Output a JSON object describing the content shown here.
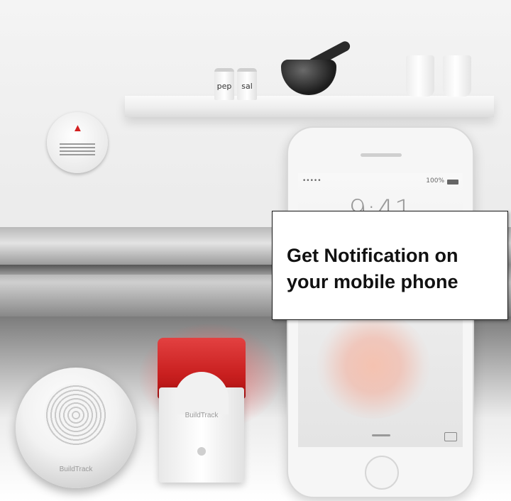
{
  "callout": {
    "line1": "Get Notification on",
    "line2": "your mobile phone"
  },
  "phone": {
    "status_battery": "100%",
    "clock": "9:41"
  },
  "products": {
    "siren_brand": "BuildTrack",
    "detector_brand": "BuildTrack"
  },
  "shelf": {
    "jar_left": "sal",
    "jar_right": "pep"
  }
}
